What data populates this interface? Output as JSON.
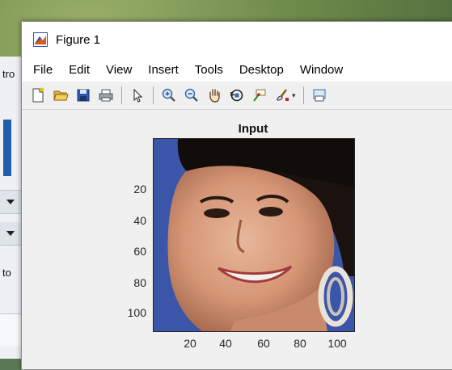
{
  "figure_window": {
    "title": "Figure 1"
  },
  "menu": {
    "items": [
      "File",
      "Edit",
      "View",
      "Insert",
      "Tools",
      "Desktop",
      "Window"
    ]
  },
  "toolbar": {
    "icons": [
      "new-figure-icon",
      "open-file-icon",
      "save-icon",
      "print-icon",
      "pointer-icon",
      "zoom-in-icon",
      "zoom-out-icon",
      "pan-hand-icon",
      "rotate-3d-icon",
      "data-cursor-icon",
      "brush-icon",
      "print-preview-icon"
    ]
  },
  "background_window": {
    "text_top": "tro",
    "text_mid": "to"
  },
  "plot": {
    "title": "Input",
    "y_ticks": [
      "20",
      "40",
      "60",
      "80",
      "100"
    ],
    "x_ticks": [
      "20",
      "40",
      "60",
      "80",
      "100"
    ],
    "image_description_icon": "face-image"
  },
  "colors": {
    "image_background": "#3b55a8",
    "accent": "#1d5fa8"
  }
}
